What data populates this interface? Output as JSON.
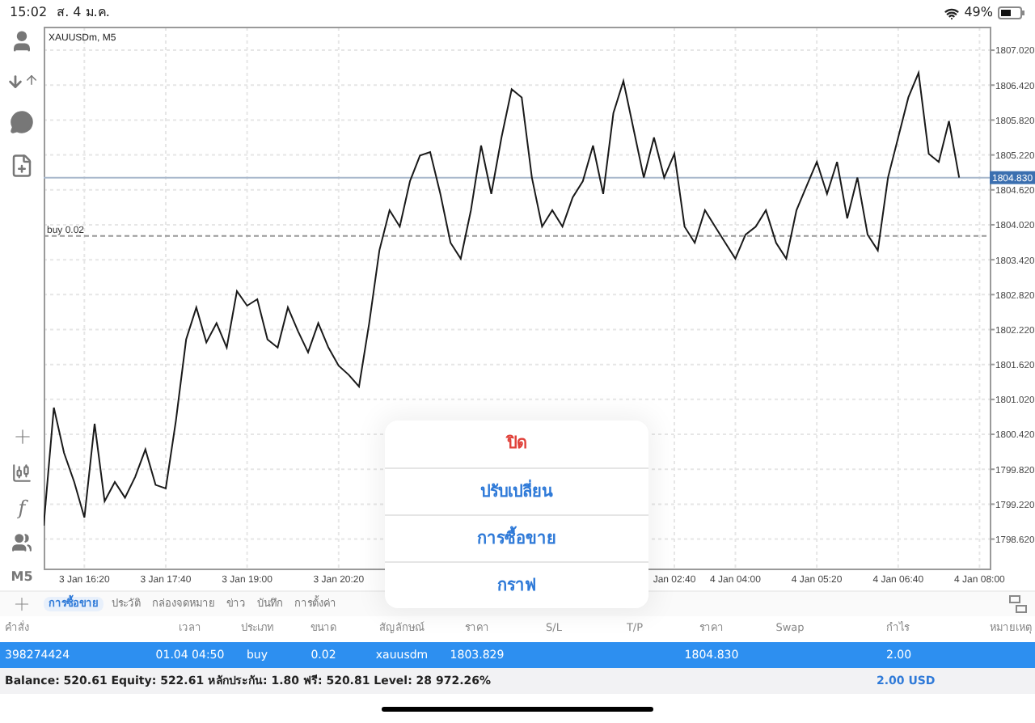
{
  "status_bar": {
    "time": "15:02",
    "date": "ส. 4 ม.ค.",
    "battery": "49%"
  },
  "toolbar": {
    "function_symbol": "f",
    "timeframe": "M5"
  },
  "chart": {
    "title": "XAUUSDm, M5",
    "chart_data": {
      "type": "line",
      "grid": true,
      "categories": [
        null,
        null,
        null,
        null,
        "3 Jan 16:20",
        null,
        null,
        null,
        null,
        null,
        null,
        null,
        "3 Jan 17:40",
        null,
        null,
        null,
        null,
        null,
        null,
        null,
        "3 Jan 19:00",
        null,
        null,
        null,
        null,
        null,
        null,
        null,
        null,
        "3 Jan 20:20",
        null,
        null,
        null,
        null,
        null,
        null,
        null,
        null,
        null,
        null,
        null,
        null,
        null,
        null,
        null,
        null,
        null,
        null,
        null,
        null,
        null,
        null,
        null,
        null,
        null,
        null,
        null,
        null,
        null,
        null,
        null,
        null,
        "Jan 02:40",
        null,
        null,
        null,
        null,
        null,
        "4 Jan 04:00",
        null,
        null,
        null,
        null,
        null,
        null,
        null,
        "4 Jan 05:20",
        null,
        null,
        null,
        null,
        null,
        null,
        null,
        "4 Jan 06:40",
        null,
        null,
        null,
        null,
        null,
        null,
        null,
        "4 Jan 08:00"
      ],
      "series": [
        {
          "color": "#1a1a1a",
          "values": [
            1798.85,
            1800.88,
            1800.1,
            1799.6,
            1798.99,
            1800.6,
            1799.27,
            1799.6,
            1799.33,
            1799.69,
            1800.16,
            1799.55,
            1799.49,
            1800.66,
            1802.05,
            1802.6,
            1802.0,
            1802.33,
            1801.91,
            1802.88,
            1802.63,
            1802.74,
            1802.05,
            1801.91,
            1802.6,
            1802.19,
            1801.83,
            1802.33,
            1801.91,
            1801.6,
            1801.44,
            1801.24,
            1802.33,
            1803.58,
            1804.27,
            1803.99,
            1804.77,
            1805.21,
            1805.27,
            1804.55,
            1803.71,
            1803.44,
            1804.27,
            1805.38,
            1804.55,
            1805.52,
            1806.35,
            1806.21,
            1804.83,
            1803.99,
            1804.27,
            1803.99,
            1804.49,
            1804.77,
            1805.38,
            1804.55,
            1805.94,
            1806.49,
            1805.66,
            1804.83,
            1805.52,
            1804.83,
            1805.24,
            1803.99,
            1803.71,
            1804.27,
            1803.99,
            1803.71,
            1803.44,
            1803.85,
            1803.99,
            1804.27,
            1803.71,
            1803.44,
            1804.27,
            1804.69,
            1805.1,
            1804.55,
            1805.1,
            1804.13,
            1804.83,
            1803.85,
            1803.58,
            1804.83,
            1805.52,
            1806.21,
            1806.63,
            1805.24,
            1805.1,
            1805.8,
            1804.83,
            null,
            null
          ]
        }
      ],
      "ylim": [
        1798.1,
        1807.41
      ],
      "yticks": [
        {
          "value": 1798.62,
          "label": "1798.620"
        },
        {
          "value": 1799.22,
          "label": "1799.220"
        },
        {
          "value": 1799.82,
          "label": "1799.820"
        },
        {
          "value": 1800.42,
          "label": "1800.420"
        },
        {
          "value": 1801.02,
          "label": "1801.020"
        },
        {
          "value": 1801.62,
          "label": "1801.620"
        },
        {
          "value": 1802.22,
          "label": "1802.220"
        },
        {
          "value": 1802.82,
          "label": "1802.820"
        },
        {
          "value": 1803.42,
          "label": "1803.420"
        },
        {
          "value": 1804.02,
          "label": "1804.020"
        },
        {
          "value": 1804.62,
          "label": "1804.620"
        },
        {
          "value": 1805.22,
          "label": "1805.220"
        },
        {
          "value": 1805.82,
          "label": "1805.820"
        },
        {
          "value": 1806.42,
          "label": "1806.420"
        },
        {
          "value": 1807.02,
          "label": "1807.020"
        }
      ],
      "ref_lines": [
        {
          "axis": "y",
          "value": 1804.83,
          "label": "1804.830",
          "color": "#a9b8cc"
        },
        {
          "axis": "y",
          "value": 1803.829,
          "label": "buy 0.02",
          "color": "#999999"
        }
      ]
    }
  },
  "context_menu": {
    "items": [
      {
        "label": "ปิด",
        "kind": "destructive"
      },
      {
        "label": "ปรับเปลี่ยน",
        "kind": "action"
      },
      {
        "label": "การซื้อขาย",
        "kind": "action"
      },
      {
        "label": "กราฟ",
        "kind": "action"
      }
    ]
  },
  "tabs": [
    {
      "label": "การซื้อขาย",
      "selected": true
    },
    {
      "label": "ประวัติ",
      "selected": false
    },
    {
      "label": "กล่องจดหมาย",
      "selected": false
    },
    {
      "label": "ข่าว",
      "selected": false
    },
    {
      "label": "บันทึก",
      "selected": false
    },
    {
      "label": "การตั้งค่า",
      "selected": false
    }
  ],
  "table": {
    "columns": [
      "คำสั่ง",
      "เวลา",
      "ประเภท",
      "ขนาด",
      "สัญลักษณ์",
      "ราคา",
      "S/L",
      "T/P",
      "ราคา",
      "Swap",
      "กำไร",
      "หมายเหตุ"
    ],
    "rows": [
      {
        "selected": true,
        "cells": {
          "order": "398274424",
          "time": "01.04 04:50",
          "type": "buy",
          "volume": "0.02",
          "symbol": "xauusdm",
          "open_price": "1803.829",
          "price": "1804.830",
          "profit": "2.00"
        }
      }
    ]
  },
  "summary": {
    "text": "Balance: 520.61 Equity: 522.61 หลักประกัน: 1.80 ฟรี: 520.81 Level: 28 972.26%",
    "profit": "2.00",
    "currency": "USD"
  }
}
